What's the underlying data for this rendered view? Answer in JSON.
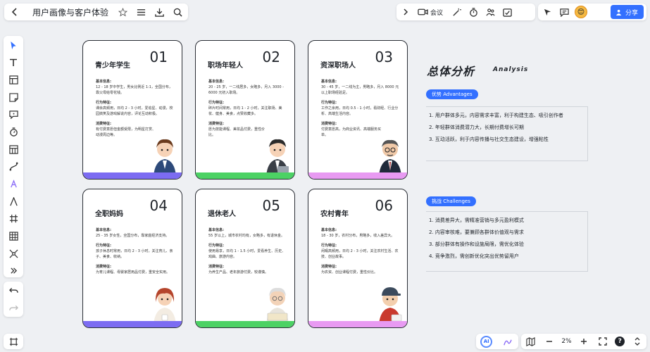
{
  "app": {
    "doc_title": "用户画像与客户体验",
    "meet_label": "会议",
    "share_label": "分享",
    "zoom": "2%",
    "ai_label": "AI",
    "help_label": "?",
    "user_initial": "😊"
  },
  "cards": [
    {
      "title": "青少年学生",
      "number": "01",
      "bar_color": "#7c6cf2",
      "basic_h": "基本信息:",
      "basic": "12 - 18 岁中学生，男女比例近 1:1，全国分布，靠父母给零花钱。",
      "behavior_h": "行为特征:",
      "behavior": "课余高频用，日均 2 - 3 小时，爱追星、动漫，校园搞笑及游戏解说内容，评论互动积极。",
      "consume_h": "消费特征:",
      "consume": "有付费意愿但金额受限，为明星打赏、动漫周边等。"
    },
    {
      "title": "职场年轻人",
      "number": "02",
      "bar_color": "#4cd264",
      "basic_h": "基本信息:",
      "basic": "20 - 25 岁，一二线居多，女略多，月入 3000 - 6000 元初入职场。",
      "behavior_h": "行为特征:",
      "behavior": "碎片时间常用，日均 1 - 2 小时，关注职场、美妆、健身、美食，点赞收藏多。",
      "consume_h": "消费特征:",
      "consume": "愿为技能课程、美妆品付费，重性价比。"
    },
    {
      "title": "资深职场人",
      "number": "03",
      "bar_color": "#e89af2",
      "basic_h": "基本信息:",
      "basic": "30 - 45 岁，一二线为主，男略多，月入 8000 元以上职场经验足。",
      "behavior_h": "行为特征:",
      "behavior": "工作之余用，日均 0.5 - 1 小时，看财经、行业分析、高端生活内容。",
      "consume_h": "消费特征:",
      "consume": "付费意愿高，为商业资讯、高端服务买单。"
    },
    {
      "title": "全职妈妈",
      "number": "04",
      "bar_color": "#7c6cf2",
      "basic_h": "基本信息:",
      "basic": "25 - 35 岁女性，全国分布，靠家庭经济支持。",
      "behavior_h": "行为特征:",
      "behavior": "孩子休息时常用，日均 2 - 3 小时，关注育儿、亲子、美食、收纳。",
      "consume_h": "消费特征:",
      "consume": "为育儿课程、母婴家居用品付费，重安全实用。"
    },
    {
      "title": "退休老人",
      "number": "05",
      "bar_color": "#4cd264",
      "basic_h": "基本信息:",
      "basic": "55 岁以上，城市农村均有，女略多，有退休金。",
      "behavior_h": "行为特征:",
      "behavior": "使用易享，日均 1 - 1.5 小时，爱看养生、历史、戏曲、旅游内容。",
      "consume_h": "消费特征:",
      "consume": "为养生产品、老年旅游付费，较谨慎。"
    },
    {
      "title": "农村青年",
      "number": "06",
      "bar_color": "#e89af2",
      "basic_h": "基本信息:",
      "basic": "18 - 30 岁，农村分布，男略多，收入差异大。",
      "behavior_h": "行为特征:",
      "behavior": "闲暇高频用，日均 2 - 3 小时，关注农村生活、农技、创业故事。",
      "consume_h": "消费特征:",
      "consume": "为农资、创业课程付费，重性价比。"
    }
  ],
  "analysis": {
    "title": "总体分析",
    "subtitle": "Analysis",
    "advantages": {
      "pill": "优势 Advantages",
      "items": [
        "1. 用户群体多元，内容需求丰富，利于构建生态、吸引创作者",
        "2. 年轻群体消费潜力大，长期付费增长可期",
        "3. 互动活跃，利于内容传播与社交生态建设，增强粘性"
      ]
    },
    "challenges": {
      "pill": "挑战 Challenges",
      "items": [
        "1. 消费差异大，需精准营销与多元盈利模式",
        "2. 内容审核难，要兼顾各群体价值观与需求",
        "3. 部分群体有操作和设施局限，需优化体验",
        "4. 竞争激烈，需创新优化突出优势留用户"
      ]
    }
  }
}
